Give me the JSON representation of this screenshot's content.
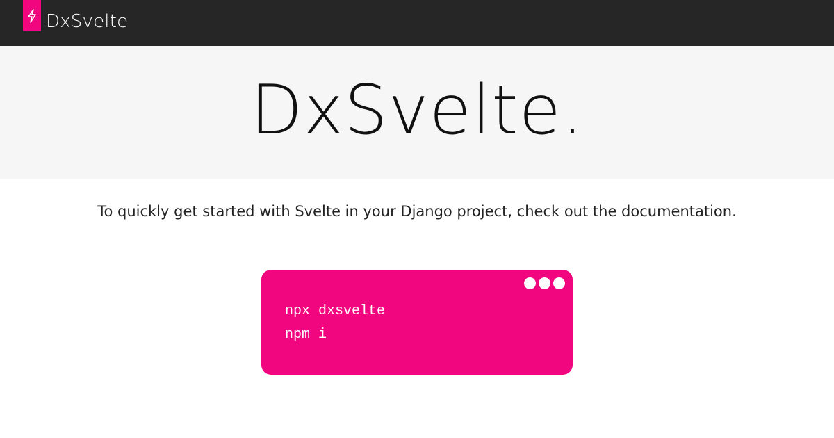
{
  "navbar": {
    "brand_name": "DxSvelte",
    "logo_icon": "lightning-bolt-icon"
  },
  "hero": {
    "title": "DxSvelte."
  },
  "main": {
    "intro_text": "To quickly get started with Svelte in your Django project, check out the documentation."
  },
  "terminal": {
    "window_controls": [
      "dot",
      "dot",
      "dot"
    ],
    "commands": [
      "npx dxsvelte",
      "npm i"
    ]
  },
  "colors": {
    "accent": "#f2067f",
    "navbar_bg": "#262626",
    "hero_bg": "#f6f6f6",
    "page_bg": "#ffffff",
    "text": "#222222"
  }
}
